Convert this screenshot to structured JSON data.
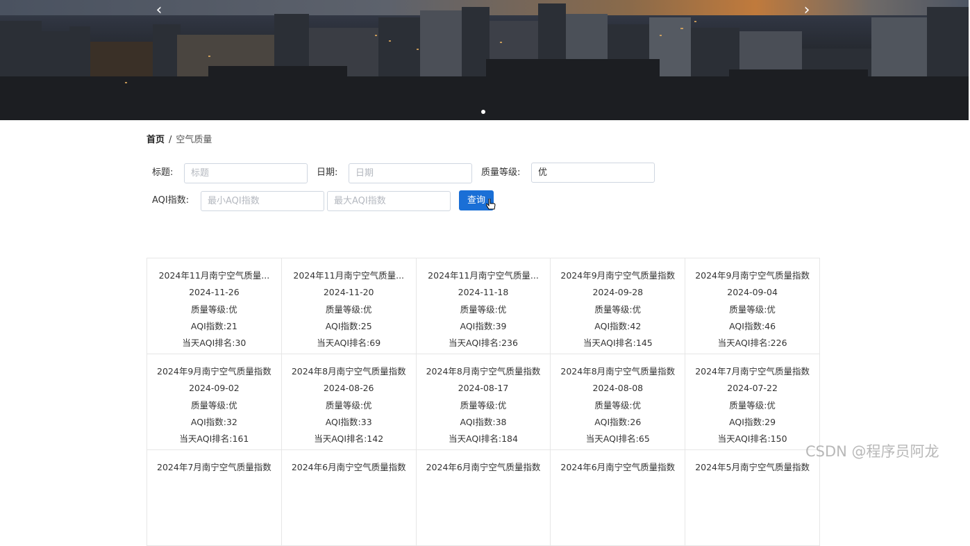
{
  "banner": {
    "prev_icon": "chevron-left-icon",
    "next_icon": "chevron-right-icon",
    "prev_glyph": "‹",
    "next_glyph": "›"
  },
  "breadcrumb": {
    "home": "首页",
    "separator": "/",
    "current": "空气质量"
  },
  "search": {
    "title_label": "标题:",
    "title_placeholder": "标题",
    "date_label": "日期:",
    "date_placeholder": "日期",
    "level_label": "质量等级:",
    "level_value": "优",
    "aqi_label": "AQI指数:",
    "aqi_min_placeholder": "最小AQI指数",
    "aqi_max_placeholder": "最大AQI指数",
    "query_button": "查询"
  },
  "cards": [
    {
      "title": "2024年11月南宁空气质量...",
      "date": "2024-11-26",
      "level": "质量等级:优",
      "aqi": "AQI指数:21",
      "rank": "当天AQI排名:30"
    },
    {
      "title": "2024年11月南宁空气质量...",
      "date": "2024-11-20",
      "level": "质量等级:优",
      "aqi": "AQI指数:25",
      "rank": "当天AQI排名:69"
    },
    {
      "title": "2024年11月南宁空气质量...",
      "date": "2024-11-18",
      "level": "质量等级:优",
      "aqi": "AQI指数:39",
      "rank": "当天AQI排名:236"
    },
    {
      "title": "2024年9月南宁空气质量指数",
      "date": "2024-09-28",
      "level": "质量等级:优",
      "aqi": "AQI指数:42",
      "rank": "当天AQI排名:145"
    },
    {
      "title": "2024年9月南宁空气质量指数",
      "date": "2024-09-04",
      "level": "质量等级:优",
      "aqi": "AQI指数:46",
      "rank": "当天AQI排名:226"
    },
    {
      "title": "2024年9月南宁空气质量指数",
      "date": "2024-09-02",
      "level": "质量等级:优",
      "aqi": "AQI指数:32",
      "rank": "当天AQI排名:161"
    },
    {
      "title": "2024年8月南宁空气质量指数",
      "date": "2024-08-26",
      "level": "质量等级:优",
      "aqi": "AQI指数:33",
      "rank": "当天AQI排名:142"
    },
    {
      "title": "2024年8月南宁空气质量指数",
      "date": "2024-08-17",
      "level": "质量等级:优",
      "aqi": "AQI指数:38",
      "rank": "当天AQI排名:184"
    },
    {
      "title": "2024年8月南宁空气质量指数",
      "date": "2024-08-08",
      "level": "质量等级:优",
      "aqi": "AQI指数:26",
      "rank": "当天AQI排名:65"
    },
    {
      "title": "2024年7月南宁空气质量指数",
      "date": "2024-07-22",
      "level": "质量等级:优",
      "aqi": "AQI指数:29",
      "rank": "当天AQI排名:150"
    },
    {
      "title": "2024年7月南宁空气质量指数",
      "date": "",
      "level": "",
      "aqi": "",
      "rank": ""
    },
    {
      "title": "2024年6月南宁空气质量指数",
      "date": "",
      "level": "",
      "aqi": "",
      "rank": ""
    },
    {
      "title": "2024年6月南宁空气质量指数",
      "date": "",
      "level": "",
      "aqi": "",
      "rank": ""
    },
    {
      "title": "2024年6月南宁空气质量指数",
      "date": "",
      "level": "",
      "aqi": "",
      "rank": ""
    },
    {
      "title": "2024年5月南宁空气质量指数",
      "date": "",
      "level": "",
      "aqi": "",
      "rank": ""
    }
  ],
  "watermark": "CSDN @程序员阿龙"
}
